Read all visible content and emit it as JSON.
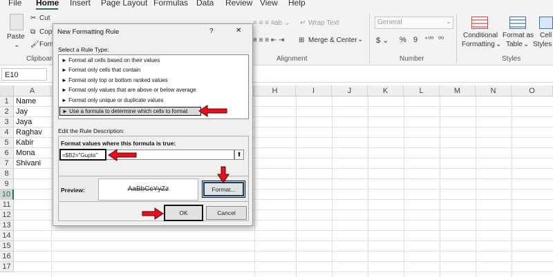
{
  "menu": [
    "File",
    "Home",
    "Insert",
    "Page Layout",
    "Formulas",
    "Data",
    "Review",
    "View",
    "Help"
  ],
  "ribbon": {
    "clipboard": {
      "paste": "Paste",
      "cut": "Cut",
      "copy": "Copy",
      "format": "Form",
      "label": "Clipboard"
    },
    "alignment": {
      "wrap": "Wrap Text",
      "merge": "Merge & Center",
      "label": "Alignment"
    },
    "number": {
      "format": "General",
      "label": "Number"
    },
    "styles": {
      "conditional": [
        "Conditional",
        "Formatting"
      ],
      "table": [
        "Format as",
        "Table"
      ],
      "cell": [
        "Cell",
        "Styles"
      ],
      "label": "Styles"
    }
  },
  "name_box": "E10",
  "columns": [
    "A",
    "",
    "",
    "",
    "",
    "",
    "",
    "",
    "H",
    "I",
    "J",
    "K",
    "L",
    "M",
    "N",
    "O"
  ],
  "rows": [
    "1",
    "2",
    "3",
    "4",
    "5",
    "6",
    "7",
    "8",
    "9",
    "10",
    "11",
    "12",
    "13",
    "14",
    "15",
    "16",
    "17"
  ],
  "selected_row": "10",
  "cells": [
    "Name",
    "Jay",
    "Jaya",
    "Raghav",
    "Kabir",
    "Mona",
    "Shivani"
  ],
  "dialog": {
    "title": "New Formatting Rule",
    "help": "?",
    "close": "✕",
    "select_label": "Select a Rule Type:",
    "rules": [
      "► Format all cells based on their values",
      "► Format only cells that contain",
      "► Format only top or bottom ranked values",
      "► Format only values that are above or below average",
      "► Format only unique or duplicate values",
      "► Use a formula to determine which cells to format"
    ],
    "edit_label": "Edit the Rule Description:",
    "formula_label": "Format values where this formula is true:",
    "formula": "=$B2=\"Gupta\"",
    "preview_label": "Preview:",
    "preview_text": "AaBbCcYyZz",
    "format_button": "Format...",
    "ok_button": "OK",
    "cancel_button": "Cancel"
  },
  "colors": {
    "accent": "#217346",
    "arrow": "#e8101e"
  }
}
